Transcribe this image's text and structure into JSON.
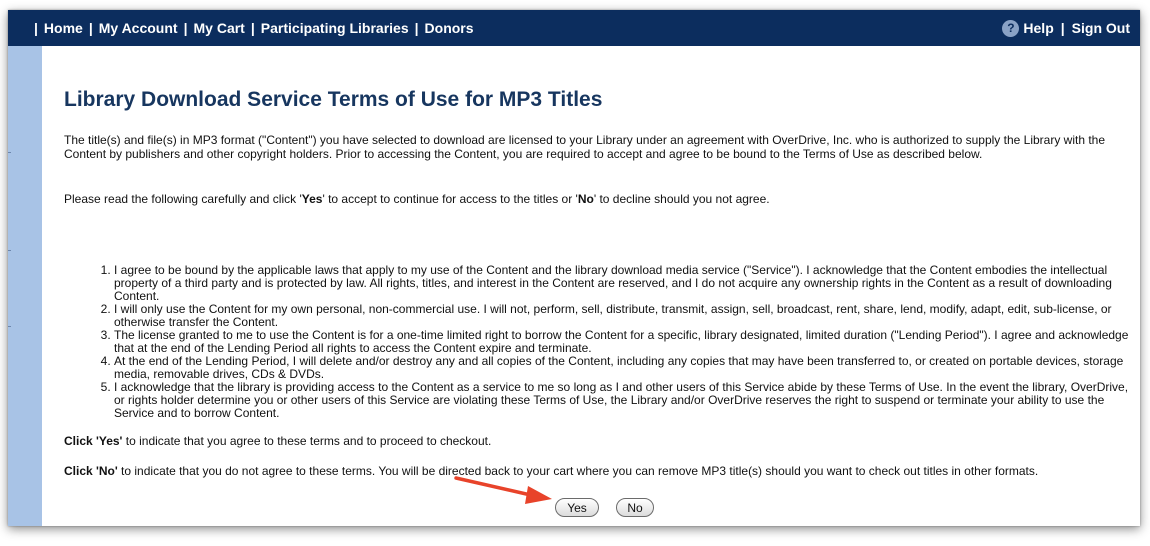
{
  "nav": {
    "lead_sep": "|",
    "links": [
      "Home",
      "My Account",
      "My Cart",
      "Participating Libraries",
      "Donors"
    ],
    "separator": "|",
    "help": "Help",
    "signout": "Sign Out",
    "help_icon_glyph": "?"
  },
  "page": {
    "title": "Library Download Service Terms of Use for MP3 Titles",
    "intro": "The title(s) and file(s) in MP3 format (\"Content\") you have selected to download are licensed to your Library under an agreement with OverDrive, Inc. who is authorized to supply the Library with the Content by publishers and other copyright holders. Prior to accessing the Content, you are required to accept and agree to be bound to the Terms of Use as described below.",
    "instruction": {
      "pre": "Please read the following carefully and click '",
      "yes": "Yes",
      "mid": "' to accept to continue for access to the titles or '",
      "no": "No",
      "post": "' to decline should you not agree."
    },
    "terms": [
      "I agree to be bound by the applicable laws that apply to my use of the Content and the library download media service (\"Service\"). I acknowledge that the Content embodies the intellectual property of a third party and is protected by law. All rights, titles, and interest in the Content are reserved, and I do not acquire any ownership rights in the Content as a result of downloading Content.",
      "I will only use the Content for my own personal, non-commercial use. I will not, perform, sell, distribute, transmit, assign, sell, broadcast, rent, share, lend, modify, adapt, edit, sub-license, or otherwise transfer the Content.",
      "The license granted to me to use the Content is for a one-time limited right to borrow the Content for a specific, library designated, limited duration (\"Lending Period\"). I agree and acknowledge that at the end of the Lending Period all rights to access the Content expire and terminate.",
      "At the end of the Lending Period, I will delete and/or destroy any and all copies of the Content, including any copies that may have been transferred to, or created on portable devices, storage media, removable drives, CDs & DVDs.",
      "I acknowledge that the library is providing access to the Content as a service to me so long as I and other users of this Service abide by these Terms of Use. In the event the library, OverDrive, or rights holder determine you or other users of this Service are violating these Terms of Use, the Library and/or OverDrive reserves the right to suspend or terminate your ability to use the Service and to borrow Content."
    ],
    "yes_note_bold": "Click 'Yes'",
    "yes_note_text": " to indicate that you agree to these terms and to proceed to checkout.",
    "no_note_bold": "Click 'No'",
    "no_note_text": " to indicate that you do not agree to these terms. You will be directed back to your cart where you can remove MP3 title(s) should you want to check out titles in other formats.",
    "yes_button": "Yes",
    "no_button": "No"
  },
  "colors": {
    "navbar": "#0c2d5e",
    "sidebar": "#a8c3e6",
    "title": "#17365f",
    "arrow": "#e8432a"
  },
  "icons": [
    "help-icon",
    "red-arrow-icon"
  ]
}
